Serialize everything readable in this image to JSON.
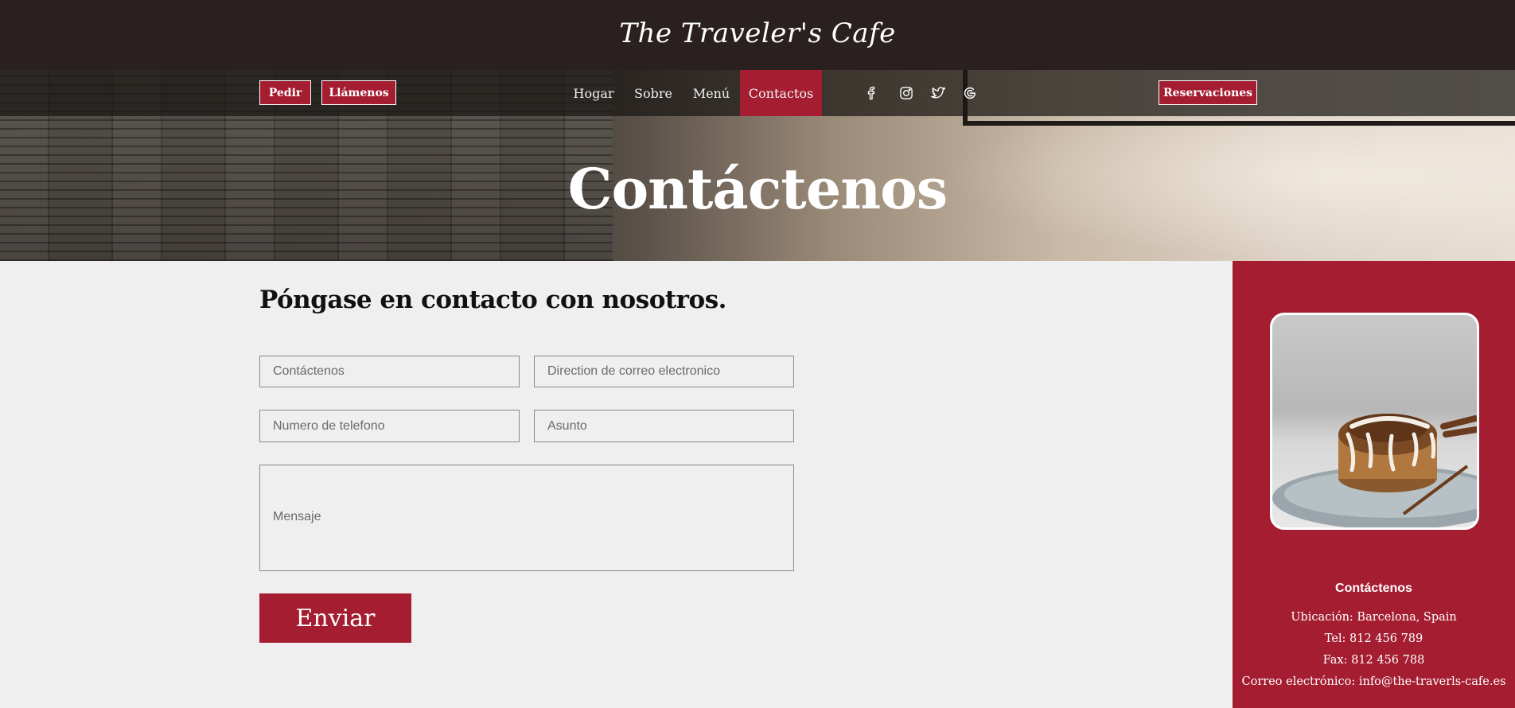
{
  "header": {
    "site_title": "The Traveler's Cafe"
  },
  "nav": {
    "order_label": "Pedir",
    "call_label": "Llámenos",
    "links": [
      "Hogar",
      "Sobre",
      "Menú",
      "Contactos"
    ],
    "active": "Contactos",
    "reservations_label": "Reservaciones",
    "social_icons": [
      "facebook-icon",
      "instagram-icon",
      "twitter-icon",
      "google-icon"
    ]
  },
  "hero": {
    "title": "Contáctenos"
  },
  "form": {
    "heading": "Póngase en contacto con nosotros.",
    "name_placeholder": "Contáctenos",
    "email_placeholder": "Direction de correo electronico",
    "phone_placeholder": "Numero de telefono",
    "subject_placeholder": "Asunto",
    "message_placeholder": "Mensaje",
    "submit_label": "Enviar"
  },
  "sidebar": {
    "title": "Contáctenos",
    "location": "Ubicación: Barcelona, Spain",
    "tel": "Tel: 812 456 789",
    "fax": "Fax: 812 456 788",
    "email": "Correo electrónico: info@the-traverls-cafe.es"
  },
  "colors": {
    "brand_red": "#a51d30",
    "top_bar": "#2a2020",
    "page_bg": "#efefef"
  }
}
